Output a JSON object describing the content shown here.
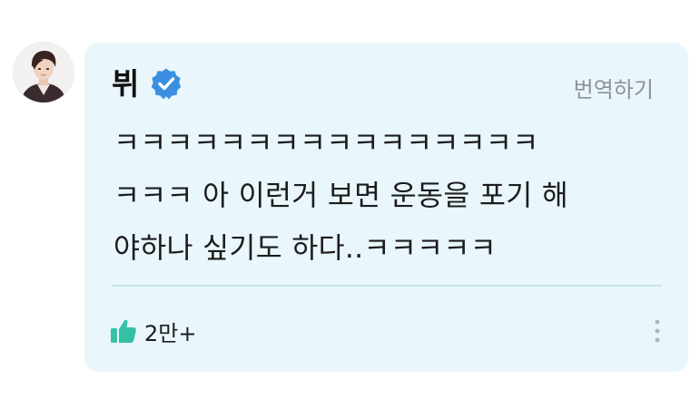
{
  "comment": {
    "author": "뷔",
    "verified_icon": "verified-badge-icon",
    "translate_label": "번역하기",
    "text": "ㅋㅋㅋㅋㅋㅋㅋㅋㅋㅋㅋㅋㅋㅋㅋㅋ\nㅋㅋㅋ 아 이런거 보면 운동을 포기 해\n야하나 싶기도 하다..ㅋㅋㅋㅋㅋ",
    "like_icon": "thumbs-up-icon",
    "like_count": "2만+",
    "more_icon": "more-vertical-icon"
  },
  "colors": {
    "bubble_background": "#e9f6fc",
    "verified_badge": "#3a8fe0",
    "like_icon": "#35c2a4",
    "translate_text": "#8e9296",
    "divider": "#c7e4ec"
  }
}
